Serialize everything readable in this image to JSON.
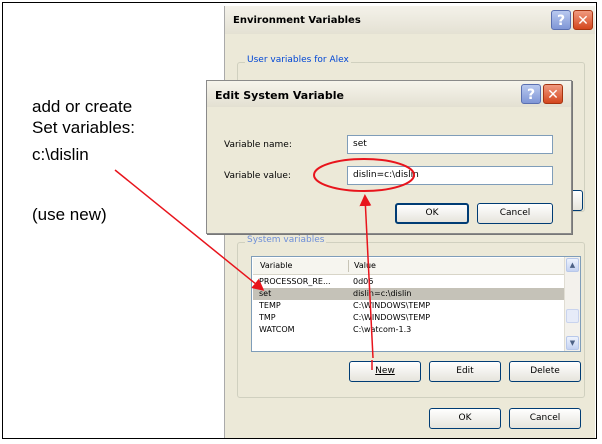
{
  "annotation": {
    "line1": "add or create",
    "line2": "Set variables:",
    "line3": "c:\\dislin",
    "line4": "(use new)",
    "color": "#e8141c"
  },
  "env_dialog": {
    "title": "Environment Variables",
    "user_group_label": "User variables for Alex",
    "system_group_label": "System variables",
    "columns": [
      "Variable",
      "Value"
    ],
    "rows": [
      {
        "variable": "PROCESSOR_RE...",
        "value": "0d06"
      },
      {
        "variable": "set",
        "value": "dislin=c:\\dislin"
      },
      {
        "variable": "TEMP",
        "value": "C:\\WINDOWS\\TEMP"
      },
      {
        "variable": "TMP",
        "value": "C:\\WINDOWS\\TEMP"
      },
      {
        "variable": "WATCOM",
        "value": "C:\\watcom-1.3"
      }
    ],
    "selected_row": 1,
    "new_label": "New",
    "edit_label": "Edit",
    "delete_label": "Delete",
    "ok_label": "OK",
    "cancel_label": "Cancel"
  },
  "edit_dialog": {
    "title": "Edit System Variable",
    "name_label": "Variable name:",
    "value_label": "Variable value:",
    "name_value": "set",
    "value_value": "dislin=c:\\dislin",
    "ok_label": "OK",
    "cancel_label": "Cancel"
  }
}
